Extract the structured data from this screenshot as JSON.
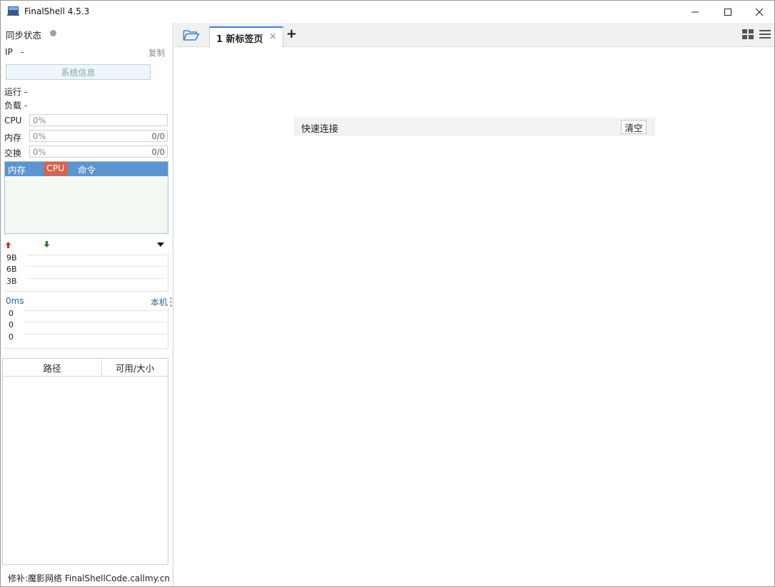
{
  "window": {
    "title": "FinalShell 4.5.3"
  },
  "sidebar": {
    "sync_label": "同步状态",
    "ip_label": "IP",
    "ip_value": "-",
    "copy_label": "复制",
    "sysinfo_label": "系统信息",
    "run_label": "运行 -",
    "load_label": "负载 -",
    "cpu": {
      "label": "CPU",
      "percent": "0%"
    },
    "memory": {
      "label": "内存",
      "percent": "0%",
      "ratio": "0/0"
    },
    "swap": {
      "label": "交换",
      "percent": "0%",
      "ratio": "0/0"
    },
    "process_columns": [
      "内存",
      "CPU",
      "命令"
    ],
    "network": {
      "yticks": [
        "9B",
        "6B",
        "3B"
      ]
    },
    "latency": {
      "value": "0ms",
      "target": "本机",
      "yticks": [
        "0",
        "0",
        "0"
      ]
    },
    "disk_columns": [
      "路径",
      "可用/大小"
    ],
    "footer": "修补:魔影网络 FinalShellCode.callmy.cn"
  },
  "tabs": [
    {
      "label": "1 新标签页",
      "active": true
    }
  ],
  "quick_connect": {
    "label": "快速连接",
    "clear_label": "清空"
  },
  "colors": {
    "accent": "#3b82d6",
    "process_header": "#5b95cf",
    "cpu_header": "#d9634d",
    "upload_arrow": "#c0392b",
    "download_arrow": "#1e7b2e"
  }
}
